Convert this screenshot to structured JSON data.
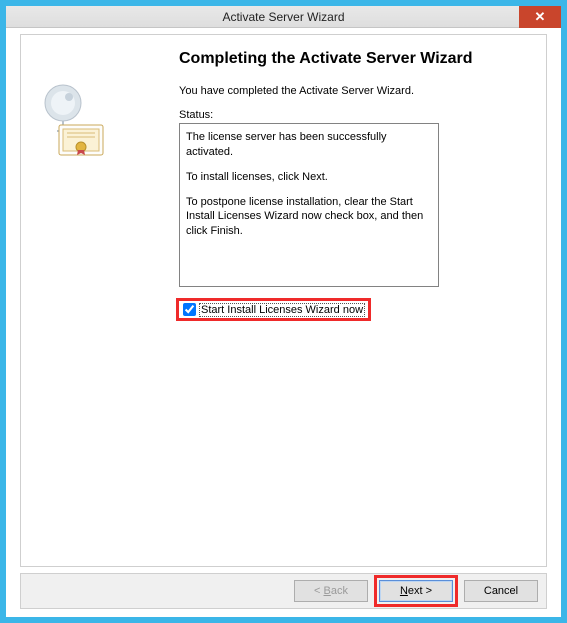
{
  "window": {
    "title": "Activate Server Wizard",
    "close_glyph": "✕"
  },
  "wizard": {
    "heading": "Completing the Activate Server Wizard",
    "intro": "You have completed the Activate Server Wizard.",
    "status_label": "Status:",
    "status_lines": {
      "line1": "The license server has been successfully activated.",
      "line2": "To install licenses, click Next.",
      "line3": "To postpone license installation, clear the Start Install Licenses Wizard now check box, and then click Finish."
    },
    "checkbox_label": "Start Install Licenses Wizard now",
    "checkbox_checked": true
  },
  "buttons": {
    "back_prefix": "< ",
    "back_key": "B",
    "back_rest": "ack",
    "next_key": "N",
    "next_rest": "ext >",
    "cancel": "Cancel"
  }
}
